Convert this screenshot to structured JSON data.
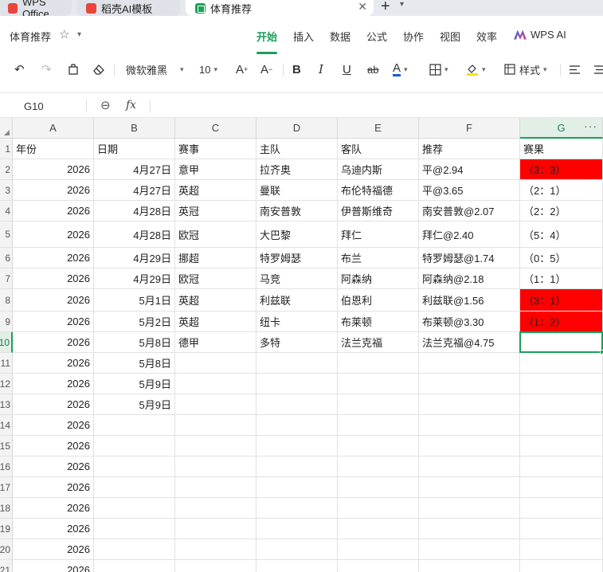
{
  "tabs": [
    {
      "label": "WPS Office"
    },
    {
      "label": "稻壳AI模板"
    },
    {
      "label": "体育推荐"
    }
  ],
  "menubar": {
    "doc_title": "体育推荐",
    "items": [
      "开始",
      "插入",
      "数据",
      "公式",
      "协作",
      "视图",
      "效率"
    ],
    "active_item": "开始",
    "ai_label": "WPS AI"
  },
  "toolbar": {
    "font_name": "微软雅黑",
    "font_size": "10",
    "style_label": "样式",
    "font_color": "#1f5bd6",
    "fill_color": "#f5e400"
  },
  "formula_bar": {
    "cell_ref": "G10",
    "fx_label": "fx",
    "value": ""
  },
  "sheet": {
    "columns": [
      "A",
      "B",
      "C",
      "D",
      "E",
      "F",
      "G"
    ],
    "selected_column": "G",
    "selected_row": 10,
    "header_row": [
      "年份",
      "日期",
      "赛事",
      "主队",
      "客队",
      "推荐",
      "赛果"
    ],
    "rows": [
      {
        "num": "2",
        "cells": [
          "2026",
          "4月27日",
          "意甲",
          "拉齐奥",
          "乌迪内斯",
          "平@2.94",
          "（3：3）"
        ],
        "g_red": true
      },
      {
        "num": "3",
        "cells": [
          "2026",
          "4月27日",
          "英超",
          "曼联",
          "布伦特福德",
          "平@3.65",
          "（2：1）"
        ],
        "g_red": false
      },
      {
        "num": "4",
        "cells": [
          "2026",
          "4月28日",
          "英冠",
          "南安普敦",
          "伊普斯维奇",
          "南安普敦@2.07",
          "（2：2）"
        ],
        "g_red": false
      },
      {
        "num": "5",
        "cells": [
          "2026",
          "4月28日",
          "欧冠",
          "大巴黎",
          "拜仁",
          "拜仁@2.40",
          "（5：4）"
        ],
        "g_red": false
      },
      {
        "num": "6",
        "cells": [
          "2026",
          "4月29日",
          "挪超",
          "特罗姆瑟",
          "布兰",
          "特罗姆瑟@1.74",
          "（0：5）"
        ],
        "g_red": false
      },
      {
        "num": "7",
        "cells": [
          "2026",
          "4月29日",
          "欧冠",
          "马竞",
          "阿森纳",
          "阿森纳@2.18",
          "（1：1）"
        ],
        "g_red": false
      },
      {
        "num": "8",
        "cells": [
          "2026",
          "5月1日",
          "英超",
          "利兹联",
          "伯恩利",
          "利兹联@1.56",
          "（3：1）"
        ],
        "g_red": true
      },
      {
        "num": "9",
        "cells": [
          "2026",
          "5月2日",
          "英超",
          "纽卡",
          "布莱顿",
          "布莱顿@3.30",
          "（1：2）"
        ],
        "g_red": true
      },
      {
        "num": "10",
        "cells": [
          "2026",
          "5月8日",
          "德甲",
          "多特",
          "法兰克福",
          "法兰克福@4.75",
          ""
        ],
        "g_red": false
      },
      {
        "num": "11",
        "cells": [
          "2026",
          "5月8日",
          "",
          "",
          "",
          "",
          ""
        ],
        "g_red": false
      },
      {
        "num": "12",
        "cells": [
          "2026",
          "5月9日",
          "",
          "",
          "",
          "",
          ""
        ],
        "g_red": false
      },
      {
        "num": "13",
        "cells": [
          "2026",
          "5月9日",
          "",
          "",
          "",
          "",
          ""
        ],
        "g_red": false
      },
      {
        "num": "14",
        "cells": [
          "2026",
          "",
          "",
          "",
          "",
          "",
          ""
        ],
        "g_red": false
      },
      {
        "num": "15",
        "cells": [
          "2026",
          "",
          "",
          "",
          "",
          "",
          ""
        ],
        "g_red": false
      },
      {
        "num": "16",
        "cells": [
          "2026",
          "",
          "",
          "",
          "",
          "",
          ""
        ],
        "g_red": false
      },
      {
        "num": "17",
        "cells": [
          "2026",
          "",
          "",
          "",
          "",
          "",
          ""
        ],
        "g_red": false
      },
      {
        "num": "18",
        "cells": [
          "2026",
          "",
          "",
          "",
          "",
          "",
          ""
        ],
        "g_red": false
      },
      {
        "num": "19",
        "cells": [
          "2026",
          "",
          "",
          "",
          "",
          "",
          ""
        ],
        "g_red": false
      },
      {
        "num": "20",
        "cells": [
          "2026",
          "",
          "",
          "",
          "",
          "",
          ""
        ],
        "g_red": false
      },
      {
        "num": "21",
        "cells": [
          "2026",
          "",
          "",
          "",
          "",
          "",
          ""
        ],
        "g_red": false
      }
    ],
    "highlight_color": "#ff0000",
    "accent_color": "#1a9f5a"
  }
}
